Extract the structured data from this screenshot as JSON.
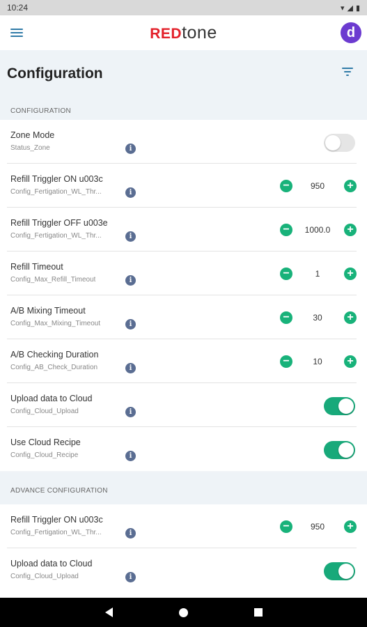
{
  "status_bar": {
    "time": "10:24"
  },
  "app_bar": {
    "logo_red": "RED",
    "logo_rest": "tone",
    "avatar_letter": "d"
  },
  "page": {
    "title": "Configuration"
  },
  "sections": [
    {
      "heading": "CONFIGURATION"
    },
    {
      "heading": "ADVANCE CONFIGURATION"
    }
  ],
  "config_rows": [
    {
      "title": "Zone Mode",
      "subtitle": "Status_Zone",
      "control": "toggle",
      "on": false
    },
    {
      "title": "Refill Triggler ON u003c",
      "subtitle": "Config_Fertigation_WL_Thr...",
      "control": "stepper",
      "value": "950"
    },
    {
      "title": "Refill Triggler OFF u003e",
      "subtitle": "Config_Fertigation_WL_Thr...",
      "control": "stepper",
      "value": "1000.0"
    },
    {
      "title": "Refill Timeout",
      "subtitle": "Config_Max_Refill_Timeout",
      "control": "stepper",
      "value": "1"
    },
    {
      "title": "A/B Mixing Timeout",
      "subtitle": "Config_Max_Mixing_Timeout",
      "control": "stepper",
      "value": "30"
    },
    {
      "title": "A/B Checking Duration",
      "subtitle": "Config_AB_Check_Duration",
      "control": "stepper",
      "value": "10"
    },
    {
      "title": "Upload data to Cloud",
      "subtitle": "Config_Cloud_Upload",
      "control": "toggle",
      "on": true
    },
    {
      "title": "Use Cloud Recipe",
      "subtitle": "Config_Cloud_Recipe",
      "control": "toggle",
      "on": true
    }
  ],
  "advance_rows": [
    {
      "title": "Refill Triggler ON u003c",
      "subtitle": "Config_Fertigation_WL_Thr...",
      "control": "stepper",
      "value": "950"
    },
    {
      "title": "Upload data to Cloud",
      "subtitle": "Config_Cloud_Upload",
      "control": "toggle",
      "on": true
    }
  ],
  "icons": {
    "menu": "hamburger-icon",
    "filter": "filter-icon",
    "info": "info-icon",
    "minus": "minus-circle-icon",
    "plus": "plus-circle-icon",
    "battery": "battery-icon",
    "wifi": "wifi-icon",
    "signal": "signal-icon"
  },
  "colors": {
    "accent": "#18a97a",
    "brand_red": "#e3202a",
    "avatar": "#6c3bd0",
    "info": "#5a6d92"
  }
}
